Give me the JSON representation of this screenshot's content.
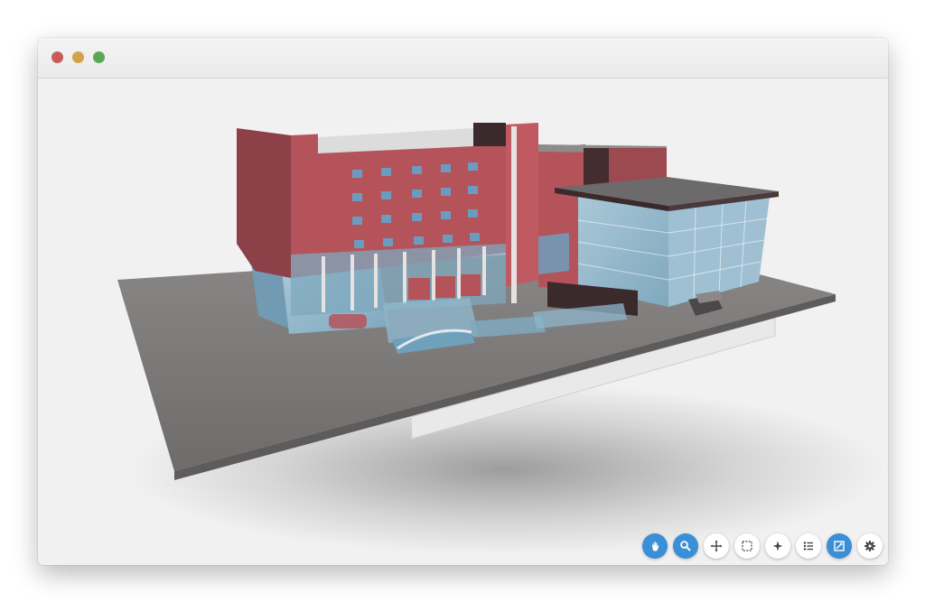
{
  "window": {
    "traffic_lights": [
      {
        "name": "close",
        "color": "#c95b5b"
      },
      {
        "name": "minimize",
        "color": "#d4a24a"
      },
      {
        "name": "maximize",
        "color": "#5aa857"
      }
    ]
  },
  "viewer": {
    "content": "3d-building-model",
    "colors": {
      "accent": "#3a8fd6",
      "facade": "#b5535a",
      "ground": "#7d7a7a",
      "glass": "#8eb6cc"
    }
  },
  "toolbar": {
    "tools": [
      {
        "icon": "orbit-hand-icon",
        "active": true
      },
      {
        "icon": "zoom-icon",
        "active": true
      },
      {
        "icon": "pan-icon",
        "active": false
      },
      {
        "icon": "fit-to-view-icon",
        "active": false
      },
      {
        "icon": "first-person-icon",
        "active": false
      },
      {
        "icon": "model-browser-icon",
        "active": false
      },
      {
        "icon": "fullscreen-icon",
        "active": true
      },
      {
        "icon": "settings-gear-icon",
        "active": false
      }
    ]
  }
}
